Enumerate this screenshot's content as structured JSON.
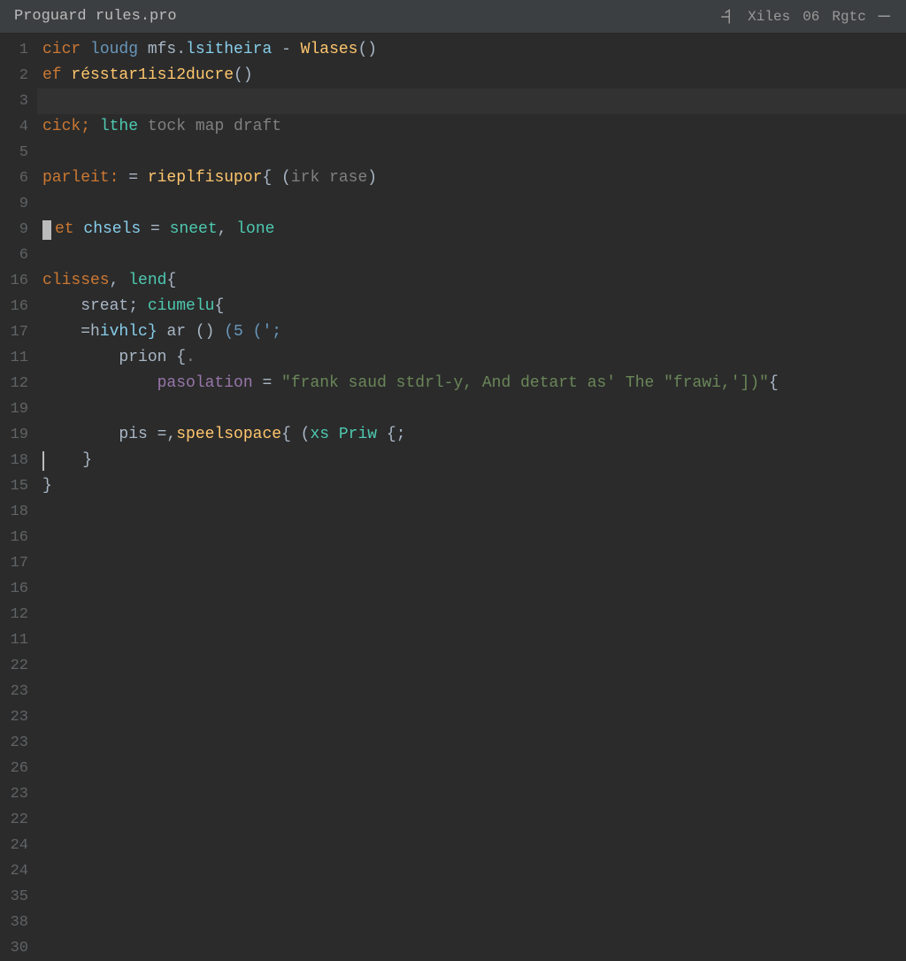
{
  "tab": {
    "title": "Proguard rules.pro"
  },
  "header": {
    "share_label": "Xiles",
    "counter": "06",
    "right_label": "Rgtc",
    "minimize": "—"
  },
  "gutter_numbers": [
    "1",
    "2",
    "3",
    "4",
    "5",
    "6",
    "9",
    "9",
    "6",
    "16",
    "16",
    "17",
    "11",
    "12",
    "19",
    "19",
    "18",
    "15",
    "18",
    "16",
    "17",
    "16",
    "12",
    "11",
    "22",
    "23",
    "23",
    "23",
    "26",
    "23",
    "22",
    "24",
    "24",
    "35",
    "38",
    "30"
  ],
  "code": {
    "l0": {
      "a": "cicr ",
      "b": "loudg ",
      "c": "mfs.",
      "d": "lsitheira",
      "e": " - ",
      "f": "Wlases",
      "g": "()"
    },
    "l1": {
      "a": "ef ",
      "b": "résstar1isi2ducre",
      "c": "()"
    },
    "l2": "",
    "l3": {
      "a": "cick; ",
      "b": "lthe ",
      "c": "tock map draft"
    },
    "l4": "",
    "l5": {
      "a": "parleit:",
      "b": " = ",
      "c": "rieplfisupor",
      "d": "{ (",
      "e": "irk rase",
      "f": ")"
    },
    "l6": "",
    "l7": {
      "a": "et ",
      "b": "chsels",
      "c": " = ",
      "d": "sneet",
      "e": ", ",
      "f": "lone"
    },
    "l8": "",
    "l9": {
      "a": "clisses",
      "b": ", ",
      "c": "lend",
      "d": "{"
    },
    "l10": {
      "a": "    sreat; ",
      "b": "ciumelu",
      "c": "{"
    },
    "l11": {
      "a": "    =h",
      "b": "ivhlc} ",
      "c": "ar () ",
      "d": "(5 (';"
    },
    "l12": {
      "a": "        prion {",
      "b": "."
    },
    "l13": {
      "a": "            pasolation",
      "b": " = ",
      "c": "\"frank saud stdrl-y, And detart as' The \"frawi,'])\"",
      "d": "{"
    },
    "l14": "",
    "l15": {
      "a": "        pis =,",
      "b": "speelsopace",
      "c": "{ (",
      "d": "xs Priw ",
      "e": "{;"
    },
    "l16": {
      "a": "    }"
    },
    "l17": {
      "a": "}"
    }
  }
}
